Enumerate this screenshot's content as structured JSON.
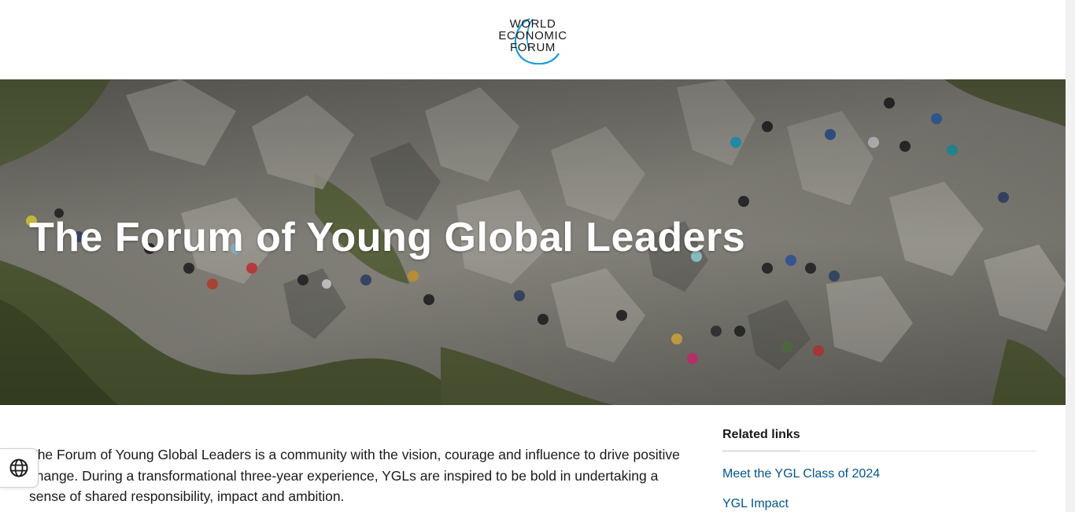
{
  "header": {
    "logo": {
      "line1": "WORLD",
      "line2": "ECONOMIC",
      "line3": "FORUM",
      "icon": "wef-logo"
    }
  },
  "hero": {
    "title": "The Forum of Young Global Leaders",
    "image": "photo of group hiking on rocky mountain trail"
  },
  "intro": {
    "text": "The Forum of Young Global Leaders is a community with the vision, courage and influence to drive positive change. During a transformational three-year experience, YGLs are inspired to be bold in undertaking a sense of shared responsibility, impact and ambition."
  },
  "related": {
    "title": "Related links",
    "links": [
      {
        "label": "Meet the YGL Class of 2024"
      },
      {
        "label": "YGL Impact"
      }
    ]
  },
  "language_button": {
    "icon": "globe-icon"
  },
  "colors": {
    "link": "#00568f",
    "logo_ring": "#1d9bd7",
    "text": "#1a1a1a"
  }
}
